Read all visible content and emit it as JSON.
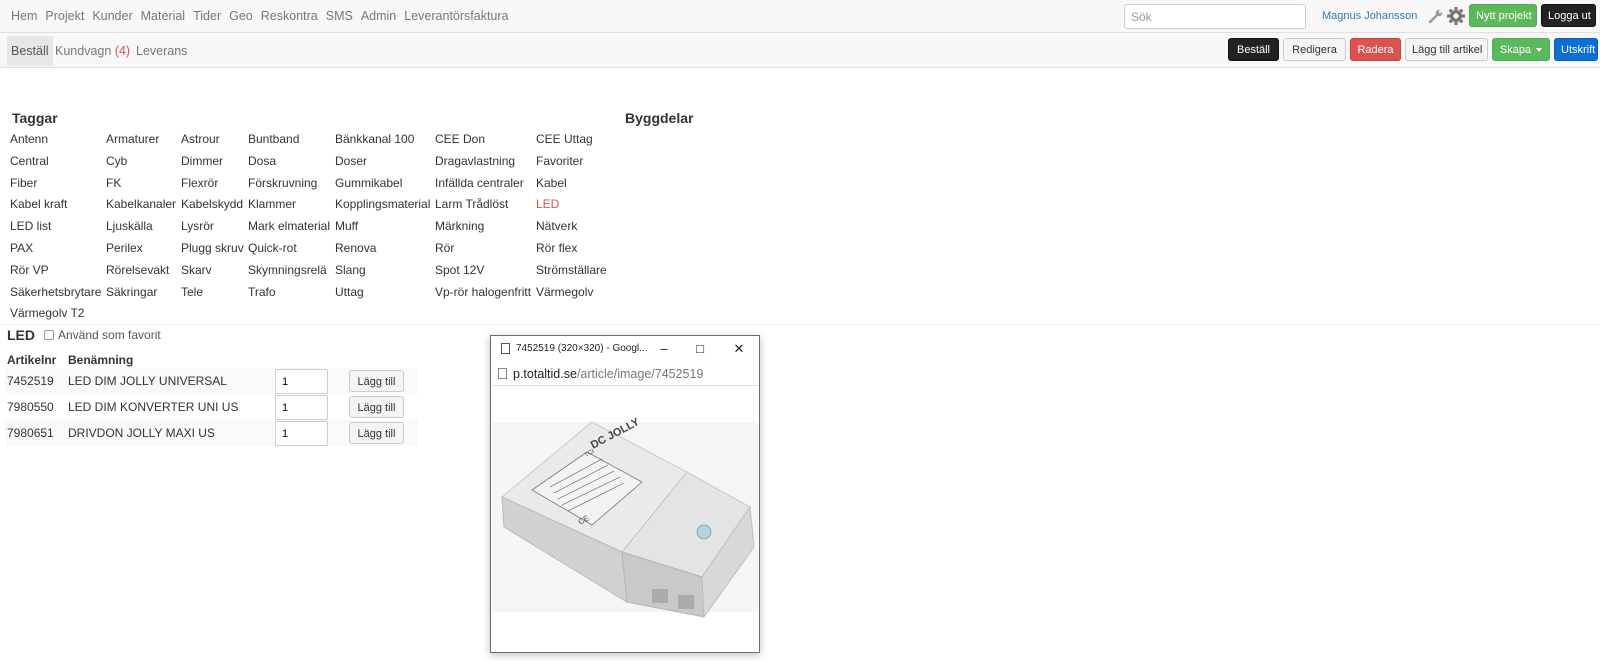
{
  "nav": {
    "items": [
      "Hem",
      "Projekt",
      "Kunder",
      "Material",
      "Tider",
      "Geo",
      "Reskontra",
      "SMS",
      "Admin",
      "Leverantörsfaktura"
    ],
    "search_placeholder": "Sök",
    "user": "Magnus Johansson",
    "new_project": "Nytt projekt",
    "logout": "Logga ut"
  },
  "subnav": {
    "active_tab": "Beställ",
    "cart_label": "Kundvagn",
    "cart_count_display": "(4)",
    "delivery": "Leverans",
    "buttons": {
      "order": "Beställ",
      "edit": "Redigera",
      "delete": "Radera",
      "add_article": "Lägg till artikel",
      "create": "Skapa",
      "print": "Utskrift"
    }
  },
  "tags": {
    "title": "Taggar",
    "rows": [
      [
        "Antenn",
        "Armaturer",
        "Astrour",
        "Buntband",
        "Bänkkanal 100",
        "CEE Don",
        "CEE Uttag"
      ],
      [
        "Central",
        "Cyb",
        "Dimmer",
        "Dosa",
        "Doser",
        "Dragavlastning",
        "Favoriter"
      ],
      [
        "Fiber",
        "FK",
        "Flexrör",
        "Förskruvning",
        "Gummikabel",
        "Infällda centraler",
        "Kabel"
      ],
      [
        "Kabel kraft",
        "Kabelkanaler",
        "Kabelskydd",
        "Klammer",
        "Kopplingsmaterial",
        "Larm Trådlöst",
        "LED"
      ],
      [
        "LED list",
        "Ljuskälla",
        "Lysrör",
        "Mark elmaterial",
        "Muff",
        "Märkning",
        "Nätverk"
      ],
      [
        "PAX",
        "Perilex",
        "Plugg skruv",
        "Quick-rot",
        "Renova",
        "Rör",
        "Rör flex"
      ],
      [
        "Rör VP",
        "Rörelsevakt",
        "Skarv",
        "Skymningsrelä",
        "Slang",
        "Spot 12V",
        "Strömställare"
      ],
      [
        "Säkerhetsbrytare",
        "Säkringar",
        "Tele",
        "Trafo",
        "Uttag",
        "Vp-rör halogenfritt",
        "Värmegolv"
      ],
      [
        "Värmegolv T2"
      ]
    ],
    "active": "LED"
  },
  "building_parts": {
    "title": "Byggdelar"
  },
  "article_list": {
    "title": "LED",
    "favorite_label": "Använd som favorit",
    "headers": [
      "Artikelnr",
      "Benämning"
    ],
    "add_label": "Lägg till",
    "rows": [
      {
        "art": "7452519",
        "name": "LED DIM JOLLY UNIVERSAL",
        "qty": "1"
      },
      {
        "art": "7980550",
        "name": "LED DIM KONVERTER UNI US",
        "qty": "1"
      },
      {
        "art": "7980651",
        "name": "DRIVDON JOLLY MAXI US",
        "qty": "1"
      }
    ]
  },
  "popup": {
    "title": "7452519 (320×320) - Googl...",
    "url_host": "p.totaltid.se",
    "url_path": "/article/image/7452519",
    "product_label": "DC JOLLY",
    "product_label_small": "TCI",
    "product_ce": "CE"
  }
}
